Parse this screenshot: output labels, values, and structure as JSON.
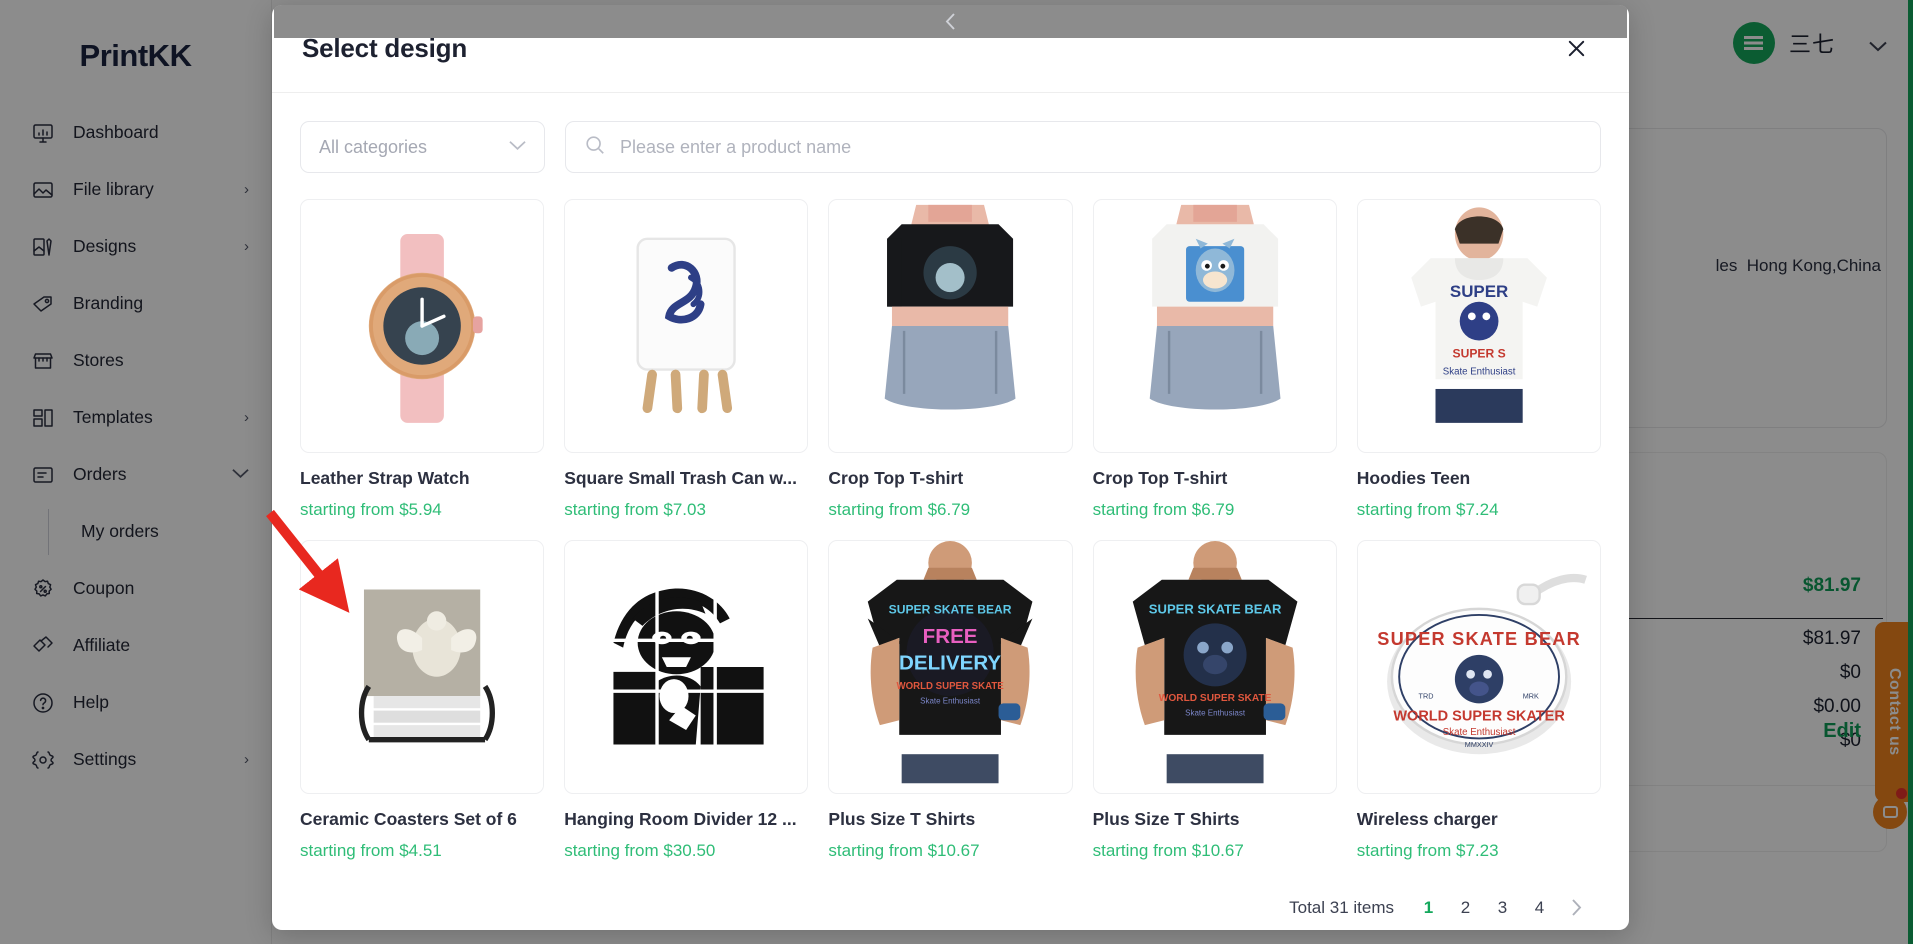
{
  "sidebar": {
    "brand": {
      "print": "Print",
      "k1": "K",
      "k2": "K"
    },
    "items": [
      {
        "label": "Dashboard",
        "icon": "dashboard-icon",
        "chevron": ""
      },
      {
        "label": "File library",
        "icon": "image-icon",
        "chevron": "›"
      },
      {
        "label": "Designs",
        "icon": "design-icon",
        "chevron": "›"
      },
      {
        "label": "Branding",
        "icon": "tag-icon",
        "chevron": ""
      },
      {
        "label": "Stores",
        "icon": "store-icon",
        "chevron": ""
      },
      {
        "label": "Templates",
        "icon": "templates-icon",
        "chevron": "›"
      },
      {
        "label": "Orders",
        "icon": "orders-icon",
        "chevron": "⌄"
      }
    ],
    "sub_item": {
      "label": "My orders"
    },
    "items_after": [
      {
        "label": "Coupon",
        "icon": "coupon-icon",
        "chevron": ""
      },
      {
        "label": "Affiliate",
        "icon": "affiliate-icon",
        "chevron": ""
      },
      {
        "label": "Help",
        "icon": "help-icon",
        "chevron": ""
      },
      {
        "label": "Settings",
        "icon": "settings-icon",
        "chevron": "›"
      }
    ]
  },
  "topbar": {
    "user_name": "三七"
  },
  "background": {
    "address": "Hong Kong,China",
    "address_prefix": "les",
    "amount_total_green": "$81.97",
    "amounts": [
      "$81.97",
      "$0",
      "$0.00",
      "$0"
    ],
    "edit_label": "Edit",
    "contact_label": "Contact us"
  },
  "modal": {
    "title": "Select design",
    "close_icon": "close-icon",
    "category": {
      "selected": "All categories",
      "icon": "chevron-down-icon"
    },
    "search": {
      "value": "",
      "placeholder": "Please enter a product name",
      "icon": "search-icon"
    },
    "products": [
      {
        "title": "Leather Strap Watch",
        "price": "starting from $5.94",
        "art": "watch"
      },
      {
        "title": "Square Small Trash Can w...",
        "price": "starting from $7.03",
        "art": "trashcan"
      },
      {
        "title": "Crop Top T-shirt",
        "price": "starting from $6.79",
        "art": "croptop-dark"
      },
      {
        "title": "Crop Top T-shirt",
        "price": "starting from $6.79",
        "art": "croptop-white"
      },
      {
        "title": "Hoodies Teen",
        "price": "starting from $7.24",
        "art": "hoodie"
      },
      {
        "title": "Ceramic Coasters Set of 6",
        "price": "starting from $4.51",
        "art": "coasters"
      },
      {
        "title": "Hanging Room Divider 12 ...",
        "price": "starting from $30.50",
        "art": "divider"
      },
      {
        "title": "Plus Size T Shirts",
        "price": "starting from $10.67",
        "art": "tshirt-free-delivery"
      },
      {
        "title": "Plus Size T Shirts",
        "price": "starting from $10.67",
        "art": "tshirt-bear"
      },
      {
        "title": "Wireless charger",
        "price": "starting from $7.23",
        "art": "charger"
      }
    ],
    "pagination": {
      "total_label": "Total 31 items",
      "prev_icon": "chevron-left-icon",
      "pages": [
        "1",
        "2",
        "3",
        "4"
      ],
      "active_page": "1",
      "next_icon": "chevron-right-icon"
    }
  },
  "annotation": {
    "arrow": "red-arrow-annotation",
    "color": "#e8281f"
  },
  "colors": {
    "accent_green": "#14a85c",
    "price_green": "#2fbd77",
    "orange": "#f0831e",
    "text_dark": "#1d2130"
  }
}
